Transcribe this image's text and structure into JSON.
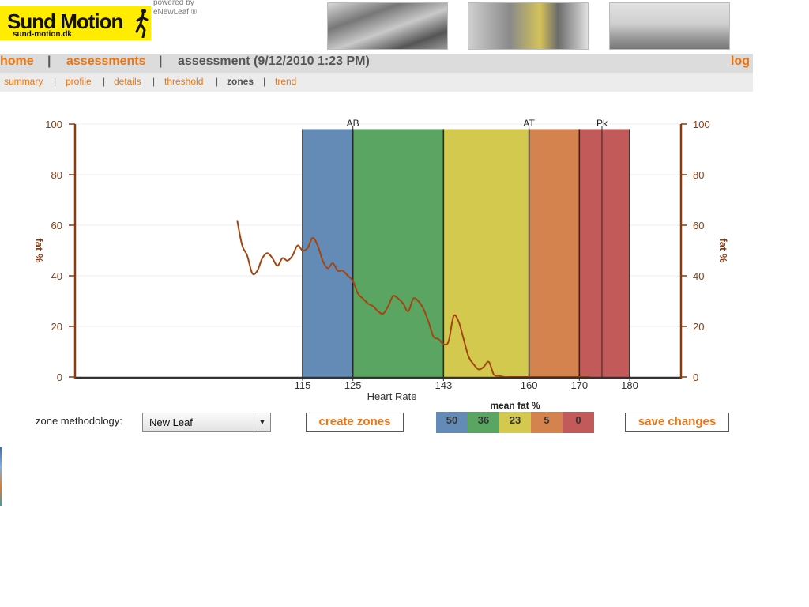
{
  "header": {
    "logo": {
      "title": "Sund Motion",
      "url": "sund-motion.dk"
    },
    "powered_by": [
      "powered by",
      "eNewLeaf ®"
    ]
  },
  "nav": {
    "home": "home",
    "sep": "|",
    "assessments": "assessments",
    "current": "assessment (9/12/2010 1:23 PM)",
    "logout": "log out"
  },
  "subnav": {
    "items": [
      "summary",
      "profile",
      "details",
      "threshold",
      "zones",
      "trend"
    ],
    "sep": "|",
    "active": "zones"
  },
  "chart_data": {
    "type": "line",
    "xlabel": "Heart Rate",
    "ylabel": "fat %",
    "y2label": "fat %",
    "ylim": [
      0,
      100
    ],
    "y_ticks": [
      0,
      20,
      40,
      60,
      80,
      100
    ],
    "x_tick_labels": [
      115,
      125,
      143,
      160,
      170,
      180
    ],
    "zones": [
      {
        "from": 115,
        "to": 125,
        "color": "#648bb5"
      },
      {
        "from": 125,
        "to": 143,
        "color": "#5aa562"
      },
      {
        "from": 143,
        "to": 160,
        "color": "#d4c94f"
      },
      {
        "from": 160,
        "to": 170,
        "color": "#d4834f"
      },
      {
        "from": 170,
        "to": 180,
        "color": "#c25a59"
      }
    ],
    "zone_top": 98,
    "markers": [
      {
        "label": "AB",
        "x": 125
      },
      {
        "label": "AT",
        "x": 160
      },
      {
        "label": "Pk",
        "x": 174.5
      }
    ],
    "line_color": "#a34511",
    "series": [
      {
        "x": [
          102,
          103,
          104,
          105,
          106,
          107,
          108,
          109,
          110,
          111,
          112,
          113,
          114,
          115,
          116,
          117,
          118,
          119,
          120,
          121,
          122,
          123,
          124,
          125,
          126,
          127,
          128,
          129,
          130,
          131,
          132,
          133,
          134,
          135,
          136,
          137,
          138,
          139,
          140,
          141,
          142,
          143,
          144,
          145,
          146,
          147,
          148,
          149,
          150,
          151,
          152,
          153,
          154,
          155,
          156,
          157,
          158,
          159,
          160,
          161,
          162,
          163,
          164,
          165,
          166,
          167,
          168,
          169,
          170,
          171,
          172
        ],
        "values": [
          62,
          52,
          48,
          41,
          42,
          47,
          49,
          47,
          44,
          47,
          46,
          48,
          52,
          50,
          51,
          55,
          52,
          46,
          43,
          45,
          42,
          42,
          40,
          38,
          33,
          31,
          29,
          28,
          26,
          25,
          28,
          32,
          31,
          29,
          26,
          31,
          30,
          27,
          22,
          16,
          15,
          13,
          14,
          24,
          22,
          15,
          8,
          5,
          3,
          4,
          6,
          1,
          0.5,
          0,
          0,
          0,
          0,
          0,
          0,
          0,
          0,
          0,
          0,
          0,
          0,
          0,
          0,
          0,
          0,
          0,
          0
        ]
      }
    ]
  },
  "controls": {
    "zone_methodology_label": "zone methodology:",
    "zone_methodology_value": "New Leaf",
    "create_zones": "create zones",
    "save_changes": "save changes",
    "mean_fat_title": "mean fat %",
    "mean_fat": [
      {
        "value": "50",
        "color": "#648bb5"
      },
      {
        "value": "36",
        "color": "#5aa562"
      },
      {
        "value": "23",
        "color": "#d4c94f"
      },
      {
        "value": "5",
        "color": "#d4834f"
      },
      {
        "value": "0",
        "color": "#c25a59"
      }
    ]
  }
}
